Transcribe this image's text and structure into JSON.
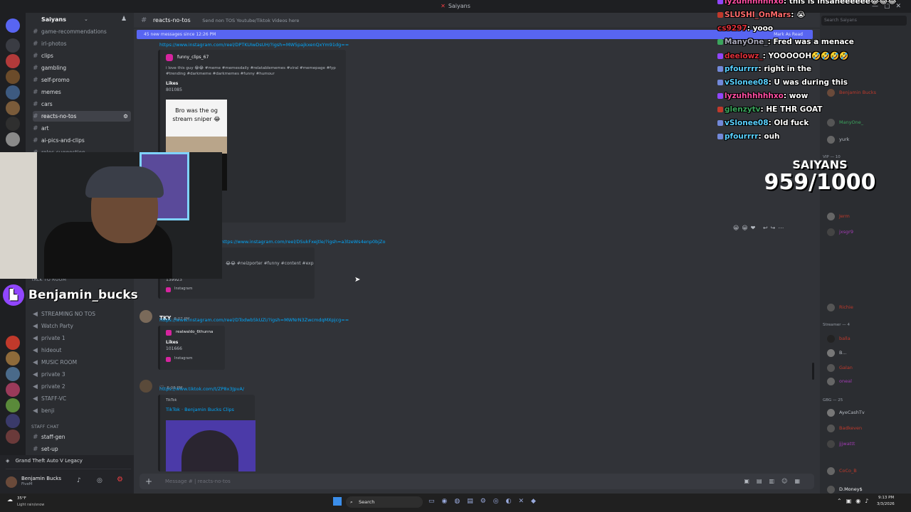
{
  "window": {
    "title": "Saiyans"
  },
  "server": {
    "name": "Saiyans",
    "channels_top": [
      {
        "label": "game-recommendations"
      },
      {
        "label": "irl-photos"
      },
      {
        "label": "clips"
      },
      {
        "label": "gambling"
      },
      {
        "label": "self-promo"
      },
      {
        "label": "memes"
      },
      {
        "label": "cars"
      },
      {
        "label": "reacts-no-tos",
        "active": true
      },
      {
        "label": "art"
      },
      {
        "label": "ai-pics-and-clips"
      },
      {
        "label": "roles-suggestion"
      }
    ],
    "voice_category": "TALK TO ROOM",
    "voice_channels": [
      {
        "label": "STREAMING NO TOS"
      },
      {
        "label": "Watch Party"
      },
      {
        "label": "private 1"
      },
      {
        "label": "hideout"
      },
      {
        "label": "MUSIC ROOM"
      },
      {
        "label": "private 3"
      },
      {
        "label": "private 2"
      },
      {
        "label": "STAFF-VC"
      },
      {
        "label": "benji"
      }
    ],
    "staff_category": "STAFF CHAT",
    "staff_channels": [
      {
        "label": "staff-gen"
      },
      {
        "label": "set-up"
      }
    ]
  },
  "activity": {
    "game": "Grand Theft Auto V Legacy"
  },
  "user": {
    "name": "Benjamin Bucks",
    "status": "FiveM"
  },
  "channel_header": {
    "name": "reacts-no-tos",
    "topic": "Send non TOS Youtube/Tiktok Videos here"
  },
  "new_banner": {
    "text": "45 new messages since 12:26 PM",
    "action": "Mark As Read"
  },
  "messages": {
    "m1": {
      "link": "https://www.instagram.com/reel/DPTKUIwDsUH/?igsh=MW5pajkxenQxYm91dg==",
      "embed_author": "funny_clips_67",
      "embed_caption": "i love this guy 😂😂 #meme #memesdaily #relatablememes #viral #memepage #fyp #trending #darkmeme #darkmemes #funny #humour",
      "likes_label": "Likes",
      "likes": "801085",
      "overlay_text": "Bro was the og stream sniper 😂"
    },
    "m2": {
      "link": "https://www.instagram.com/reel/DSukFxejtle/?igsh=a3lzeWs4enp0bjZo",
      "caption": "😂😂 #neizporter #funny #content #exp",
      "likes": "139923",
      "footer": "Instagram"
    },
    "m3": {
      "author": "TKY",
      "time": "8:07 PM",
      "link": "https://www.instagram.com/reel/DTodwb5kUZi/?igsh=MWNrN3ZwcmdqMXpjcg==",
      "embed_author": "realwaldo_6thunna",
      "likes_label": "Likes",
      "likes": "101666",
      "footer": "Instagram"
    },
    "m4": {
      "author": "",
      "time": "8:08 PM",
      "link": "https://www.tiktok.com/t/ZP8x3JpvA/",
      "provider": "TikTok",
      "title": "TikTok · Benjamin Bucks Clips"
    }
  },
  "composer": {
    "placeholder": "Message # | reacts-no-tos"
  },
  "member_search": {
    "placeholder": "Search Saiyans"
  },
  "members": {
    "cat_vip": "VIP — 10",
    "cat_streamer": "Streamer — 4",
    "cat_gbg": "GBG — 25",
    "top_names": [
      "Benjamin Bucks",
      "ManyOne_",
      "yurk"
    ],
    "vip_names": [
      "Jerm",
      "jxsgr9",
      "Richie"
    ],
    "streamer_names": [
      "balla",
      "B...",
      "Galan",
      "oneal"
    ],
    "gbg_names": [
      "AyeCashTv",
      "Badkeven",
      "jjjwattt",
      "CoCo_B",
      "D.Money$"
    ]
  },
  "chat_overlay": [
    {
      "user": "lyzuhhhhhhxo",
      "msg": "this is insaneeeeee😂😂😂"
    },
    {
      "user": "SLUSHI_OnMars",
      "msg": "😭"
    },
    {
      "user": "cs9297",
      "msg": "yooo"
    },
    {
      "user": "ManyOne_",
      "msg": "Fred was a menace"
    },
    {
      "user": "deelowz_",
      "msg": "YOOOOOH🤣🤣🤣🤣"
    },
    {
      "user": "pfourrrr",
      "msg": "right in the"
    },
    {
      "user": "vSlonee08",
      "msg": "U was    during this"
    },
    {
      "user": "lyzuhhhhhhxo",
      "msg": "wow"
    },
    {
      "user": "glenzytv",
      "msg": "HE THR GOAT"
    },
    {
      "user": "vSlonee08",
      "msg": "Old fuck"
    },
    {
      "user": "pfourrrr",
      "msg": "ouh"
    }
  ],
  "sub_counter": {
    "label": "SAIYANS",
    "value": "959/1000"
  },
  "twitch_tag": {
    "name": "Benjamin_bucks"
  },
  "taskbar": {
    "weather": "35°F",
    "weather_desc": "Light rain/snow",
    "search": "Search",
    "time": "9:13 PM",
    "date": "3/3/2026"
  },
  "colors": {
    "blurple": "#5865f2",
    "link": "#00a8fc",
    "twitch": "#9146ff"
  }
}
